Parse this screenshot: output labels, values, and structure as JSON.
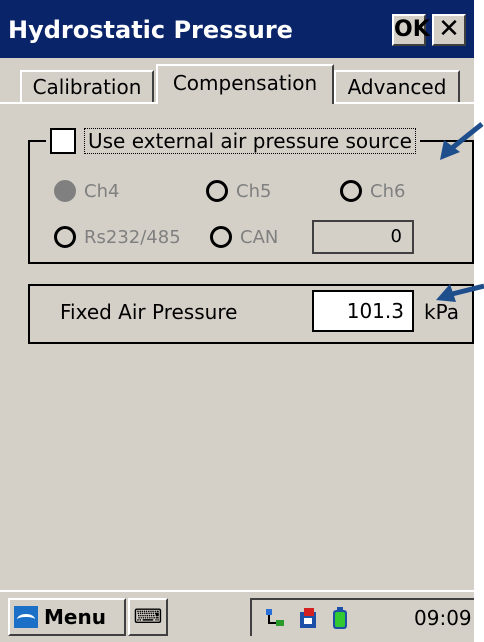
{
  "window": {
    "title": "Hydrostatic Pressure",
    "ok_label": "OK",
    "close_label": "✕"
  },
  "tabs": [
    {
      "label": "Calibration",
      "active": false
    },
    {
      "label": "Compensation",
      "active": true
    },
    {
      "label": "Advanced",
      "active": false
    }
  ],
  "external_source": {
    "checkbox_label": "Use external air pressure source",
    "checked": false,
    "radios": [
      {
        "label": "Ch4",
        "selected": true,
        "enabled": false
      },
      {
        "label": "Ch5",
        "selected": false,
        "enabled": false
      },
      {
        "label": "Ch6",
        "selected": false,
        "enabled": false
      },
      {
        "label": "Rs232/485",
        "selected": false,
        "enabled": false
      },
      {
        "label": "CAN",
        "selected": false,
        "enabled": false
      }
    ],
    "can_value": "0"
  },
  "fixed_pressure": {
    "label": "Fixed Air Pressure",
    "value": "101.3",
    "unit": "kPa"
  },
  "taskbar": {
    "menu_label": "Menu",
    "keyboard_icon": "keyboard-icon",
    "clock": "09:09"
  },
  "colors": {
    "title_bar": "#0a246a",
    "face": "#d4d0c8",
    "arrow": "#1f4e8c"
  }
}
